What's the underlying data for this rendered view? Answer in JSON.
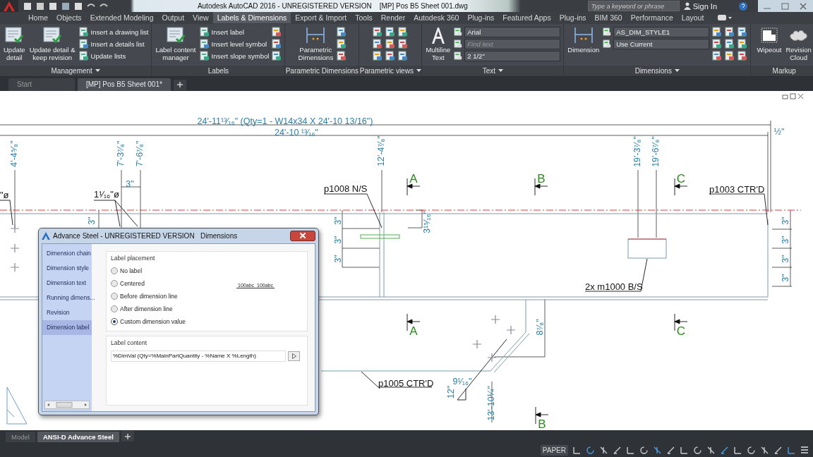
{
  "title_bar": {
    "title": "Autodesk AutoCAD 2016 - UNREGISTERED VERSION    [MP] Pos B5 Sheet 001.dwg",
    "search": {
      "placeholder": "Type a keyword or phrase"
    },
    "sign_in": "Sign In"
  },
  "ribbon_tabs": [
    {
      "label": "Home",
      "selected": false
    },
    {
      "label": "Objects",
      "selected": false
    },
    {
      "label": "Extended Modeling",
      "selected": false
    },
    {
      "label": "Output",
      "selected": false
    },
    {
      "label": "View",
      "selected": false
    },
    {
      "label": "Labels & Dimensions",
      "selected": true
    },
    {
      "label": "Export & Import",
      "selected": false
    },
    {
      "label": "Tools",
      "selected": false
    },
    {
      "label": "Render",
      "selected": false
    },
    {
      "label": "Autodesk 360",
      "selected": false
    },
    {
      "label": "Plug-ins",
      "selected": false
    },
    {
      "label": "Featured Apps",
      "selected": false
    },
    {
      "label": "Plug-ins",
      "selected": false
    },
    {
      "label": "BIM 360",
      "selected": false
    },
    {
      "label": "Performance",
      "selected": false
    },
    {
      "label": "Layout",
      "selected": false
    }
  ],
  "ribbon_panels": [
    {
      "title": "Management",
      "menu": true,
      "columns": [
        {
          "kind": "large",
          "label": "Update\ndetail"
        },
        {
          "kind": "large",
          "label": "Update detail &\nkeep revision"
        },
        {
          "kind": "list",
          "items": [
            {
              "label": "Insert a drawing list"
            },
            {
              "label": "Insert a details list"
            },
            {
              "label": "Update lists"
            }
          ]
        }
      ]
    },
    {
      "title": "Labels",
      "menu": false,
      "columns": [
        {
          "kind": "large",
          "label": "Label content\nmanager"
        },
        {
          "kind": "list",
          "items": [
            {
              "label": "Insert label"
            },
            {
              "label": "Insert level symbol"
            },
            {
              "label": "Insert slope symbol"
            }
          ]
        },
        {
          "kind": "icon_column"
        }
      ]
    },
    {
      "title": "Parametric Dimensions",
      "menu": false,
      "columns": [
        {
          "kind": "large",
          "label": "Parametric\nDimensions"
        },
        {
          "kind": "icon_column"
        }
      ]
    },
    {
      "title": "Parametric views",
      "menu": true,
      "columns": [
        {
          "kind": "icon_column"
        },
        {
          "kind": "icon_column"
        },
        {
          "kind": "icon_column"
        }
      ]
    },
    {
      "title": "Text",
      "menu": true,
      "columns": [
        {
          "kind": "large",
          "label": "Multiline\nText"
        },
        {
          "kind": "combo_list",
          "items": [
            {
              "value": "Arial"
            },
            {
              "placeholder": "Find text"
            },
            {
              "value": "2 1/2\""
            }
          ]
        }
      ]
    },
    {
      "title": "Dimensions",
      "menu": true,
      "columns": [
        {
          "kind": "large",
          "label": "Dimension"
        },
        {
          "kind": "combo_list",
          "items": [
            {
              "value": "AS_DIM_STYLE1"
            },
            {
              "value": "Use Current"
            }
          ]
        },
        {
          "kind": "icon_column"
        },
        {
          "kind": "icon_column"
        },
        {
          "kind": "icon_column"
        }
      ]
    },
    {
      "title": "Markup",
      "menu": false,
      "columns": [
        {
          "kind": "large",
          "label": "Wipeout"
        },
        {
          "kind": "large",
          "label": "Revision\nCloud"
        }
      ]
    }
  ],
  "document_tabs": [
    {
      "label": "Start",
      "selected": false
    },
    {
      "label": "[MP] Pos B5 Sheet 001*",
      "selected": true
    }
  ],
  "drawing": {
    "dimension_texts": [
      "24'-11¹³⁄₁₆\" (Qty=1 - W14x34 X 24'-10 13/16\")",
      "24'-10 ¹³⁄₁₆\"",
      "4'-4⁵⁄₈\"",
      "7'-3⁷⁄₈\"",
      "7'-6⁷⁄₈\"",
      "3\"",
      "3\"",
      "12'-4⁷⁄₈\"",
      "3\"",
      "3\"",
      "3\"",
      "3¹⁵⁄₁₆\"",
      "19'-3⁷⁄₈\"",
      "19'-6⁷⁄₈\"",
      "½\"",
      "3\"",
      "3\"",
      "3\"",
      "3\"",
      "8⁷⁄₈\"",
      "9¹⁄₁₆\"",
      "12\"",
      "13'-10¼\""
    ],
    "labels": [
      "\"ø",
      "1¹⁄₁₆\"ø",
      "p1008 N/S",
      "p1003 CTR'D",
      "2x m1000 B/S",
      "p1005 CTR'D"
    ],
    "section_marks": [
      "A",
      "B",
      "C",
      "A",
      "C",
      "B"
    ]
  },
  "dialog": {
    "title": "Advance Steel - UNREGISTERED VERSION   Dimensions",
    "nav": [
      {
        "label": "Dimension chain",
        "selected": false
      },
      {
        "label": "Dimension style",
        "selected": false
      },
      {
        "label": "Dimension text",
        "selected": false
      },
      {
        "label": "Running dimens...",
        "selected": false
      },
      {
        "label": "Revision",
        "selected": false
      },
      {
        "label": "Dimension label",
        "selected": true
      }
    ],
    "placement_group": "Label placement",
    "placement_options": [
      {
        "label": "No label",
        "selected": false
      },
      {
        "label": "Centered",
        "selected": false
      },
      {
        "label": "Before dimension line",
        "selected": false
      },
      {
        "label": "After dimension line",
        "selected": false
      },
      {
        "label": "Custom dimension value",
        "selected": true
      }
    ],
    "preview": [
      "100abc",
      "100abc"
    ],
    "content_group": "Label content",
    "content_field": {
      "value": "%DimVal (Qty=%MainPartQuantity - %Name X %Length)"
    }
  },
  "layout_tabs": [
    {
      "label": "Model",
      "selected": false
    },
    {
      "label": "ANSI-D Advance Steel",
      "selected": true
    }
  ],
  "status_bar": {
    "space": "PAPER"
  }
}
